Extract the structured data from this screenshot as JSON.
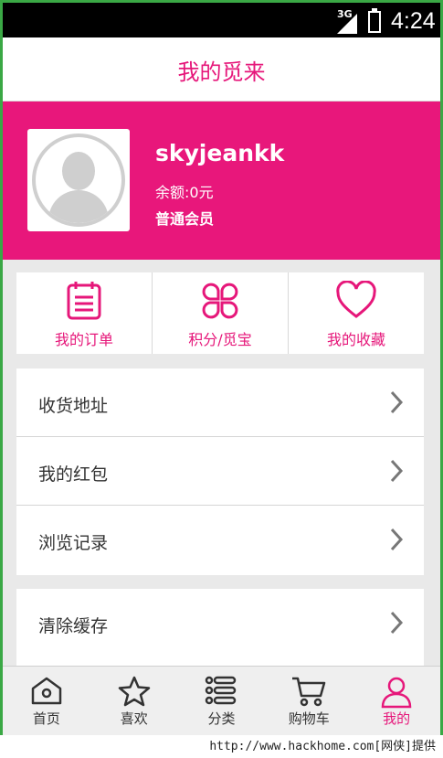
{
  "status_bar": {
    "network": "3G",
    "time": "4:24"
  },
  "header": {
    "title": "我的觅来"
  },
  "profile": {
    "username": "skyjeankk",
    "balance": "余额:0元",
    "member_level": "普通会员"
  },
  "quick_actions": [
    {
      "label": "我的订单",
      "icon": "order-list-icon"
    },
    {
      "label": "积分/觅宝",
      "icon": "clover-icon"
    },
    {
      "label": "我的收藏",
      "icon": "heart-icon"
    }
  ],
  "menu_group_1": [
    {
      "label": "收货地址"
    },
    {
      "label": "我的红包"
    },
    {
      "label": "浏览记录"
    }
  ],
  "menu_group_2": [
    {
      "label": "清除缓存"
    }
  ],
  "bottom_nav": [
    {
      "label": "首页",
      "icon": "home-icon"
    },
    {
      "label": "喜欢",
      "icon": "star-icon"
    },
    {
      "label": "分类",
      "icon": "category-list-icon"
    },
    {
      "label": "购物车",
      "icon": "cart-icon"
    },
    {
      "label": "我的",
      "icon": "user-icon",
      "active": true
    }
  ],
  "colors": {
    "accent": "#e8177b",
    "chevron": "#777777"
  },
  "watermark": "http://www.hackhome.com[网侠]提供"
}
